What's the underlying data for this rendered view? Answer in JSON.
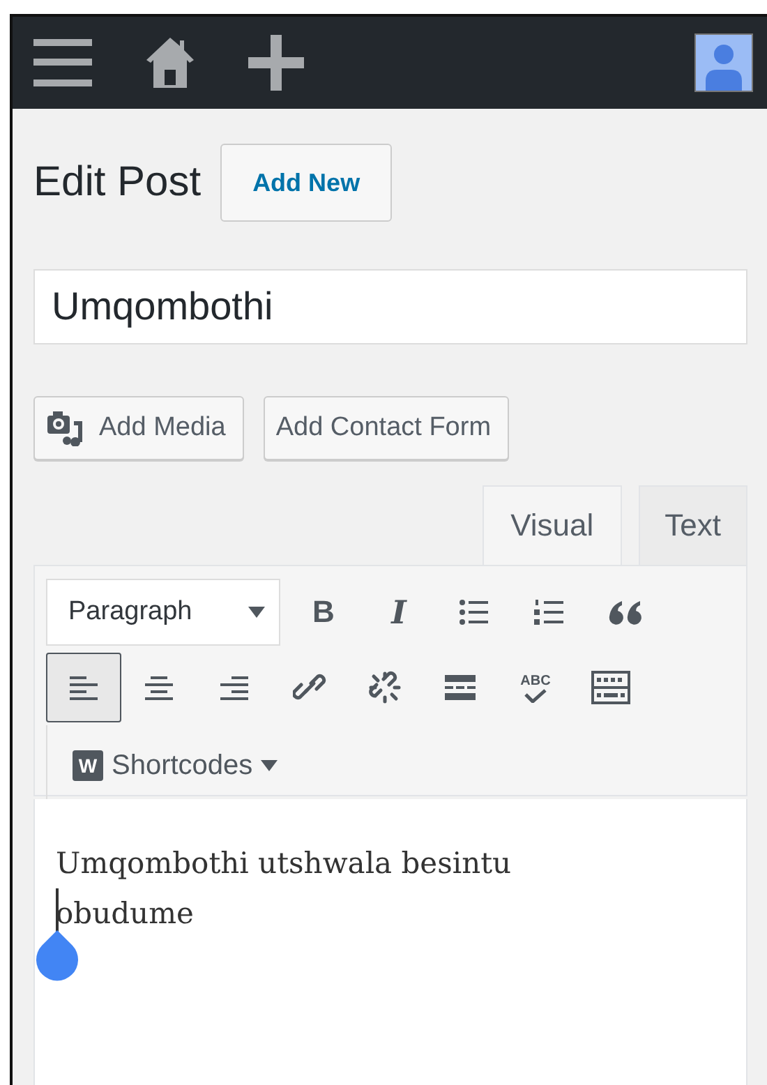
{
  "top_bar": {
    "items": [
      {
        "kind": "menu"
      },
      {
        "kind": "home"
      },
      {
        "kind": "add"
      }
    ]
  },
  "heading": {
    "title": "Edit Post",
    "button": "Add New"
  },
  "post_title": {
    "value": "Umqombothi"
  },
  "media_buttons": [
    {
      "label": "Add Media",
      "kind": "media"
    },
    {
      "label": "Add Contact Form",
      "kind": "plain"
    }
  ],
  "editor_tabs": [
    {
      "label": "Visual",
      "selected": true
    },
    {
      "label": "Text",
      "selected": false
    }
  ],
  "toolbar": {
    "format": {
      "value": "Paragraph"
    },
    "row_1": [
      {
        "kind": "bold",
        "label": "B",
        "selected": false
      },
      {
        "kind": "italic",
        "label": "I",
        "selected": false
      },
      {
        "kind": "bullets",
        "selected": false
      },
      {
        "kind": "numbers",
        "selected": false
      },
      {
        "kind": "quote",
        "selected": false
      }
    ],
    "row_2": [
      {
        "kind": "align-left",
        "selected": true
      },
      {
        "kind": "align-center",
        "selected": false
      },
      {
        "kind": "align-right",
        "selected": false
      },
      {
        "kind": "link",
        "selected": false
      },
      {
        "kind": "unlink",
        "selected": false
      },
      {
        "kind": "more",
        "selected": false
      },
      {
        "kind": "spellcheck",
        "label": "ABC",
        "selected": false
      },
      {
        "kind": "kitchen-sink",
        "selected": false
      }
    ],
    "shortcodes": {
      "badge": "W",
      "label": "Shortcodes"
    }
  },
  "content": {
    "text": "Umqombothi utshwala besintu obudume",
    "cursor": true
  }
}
